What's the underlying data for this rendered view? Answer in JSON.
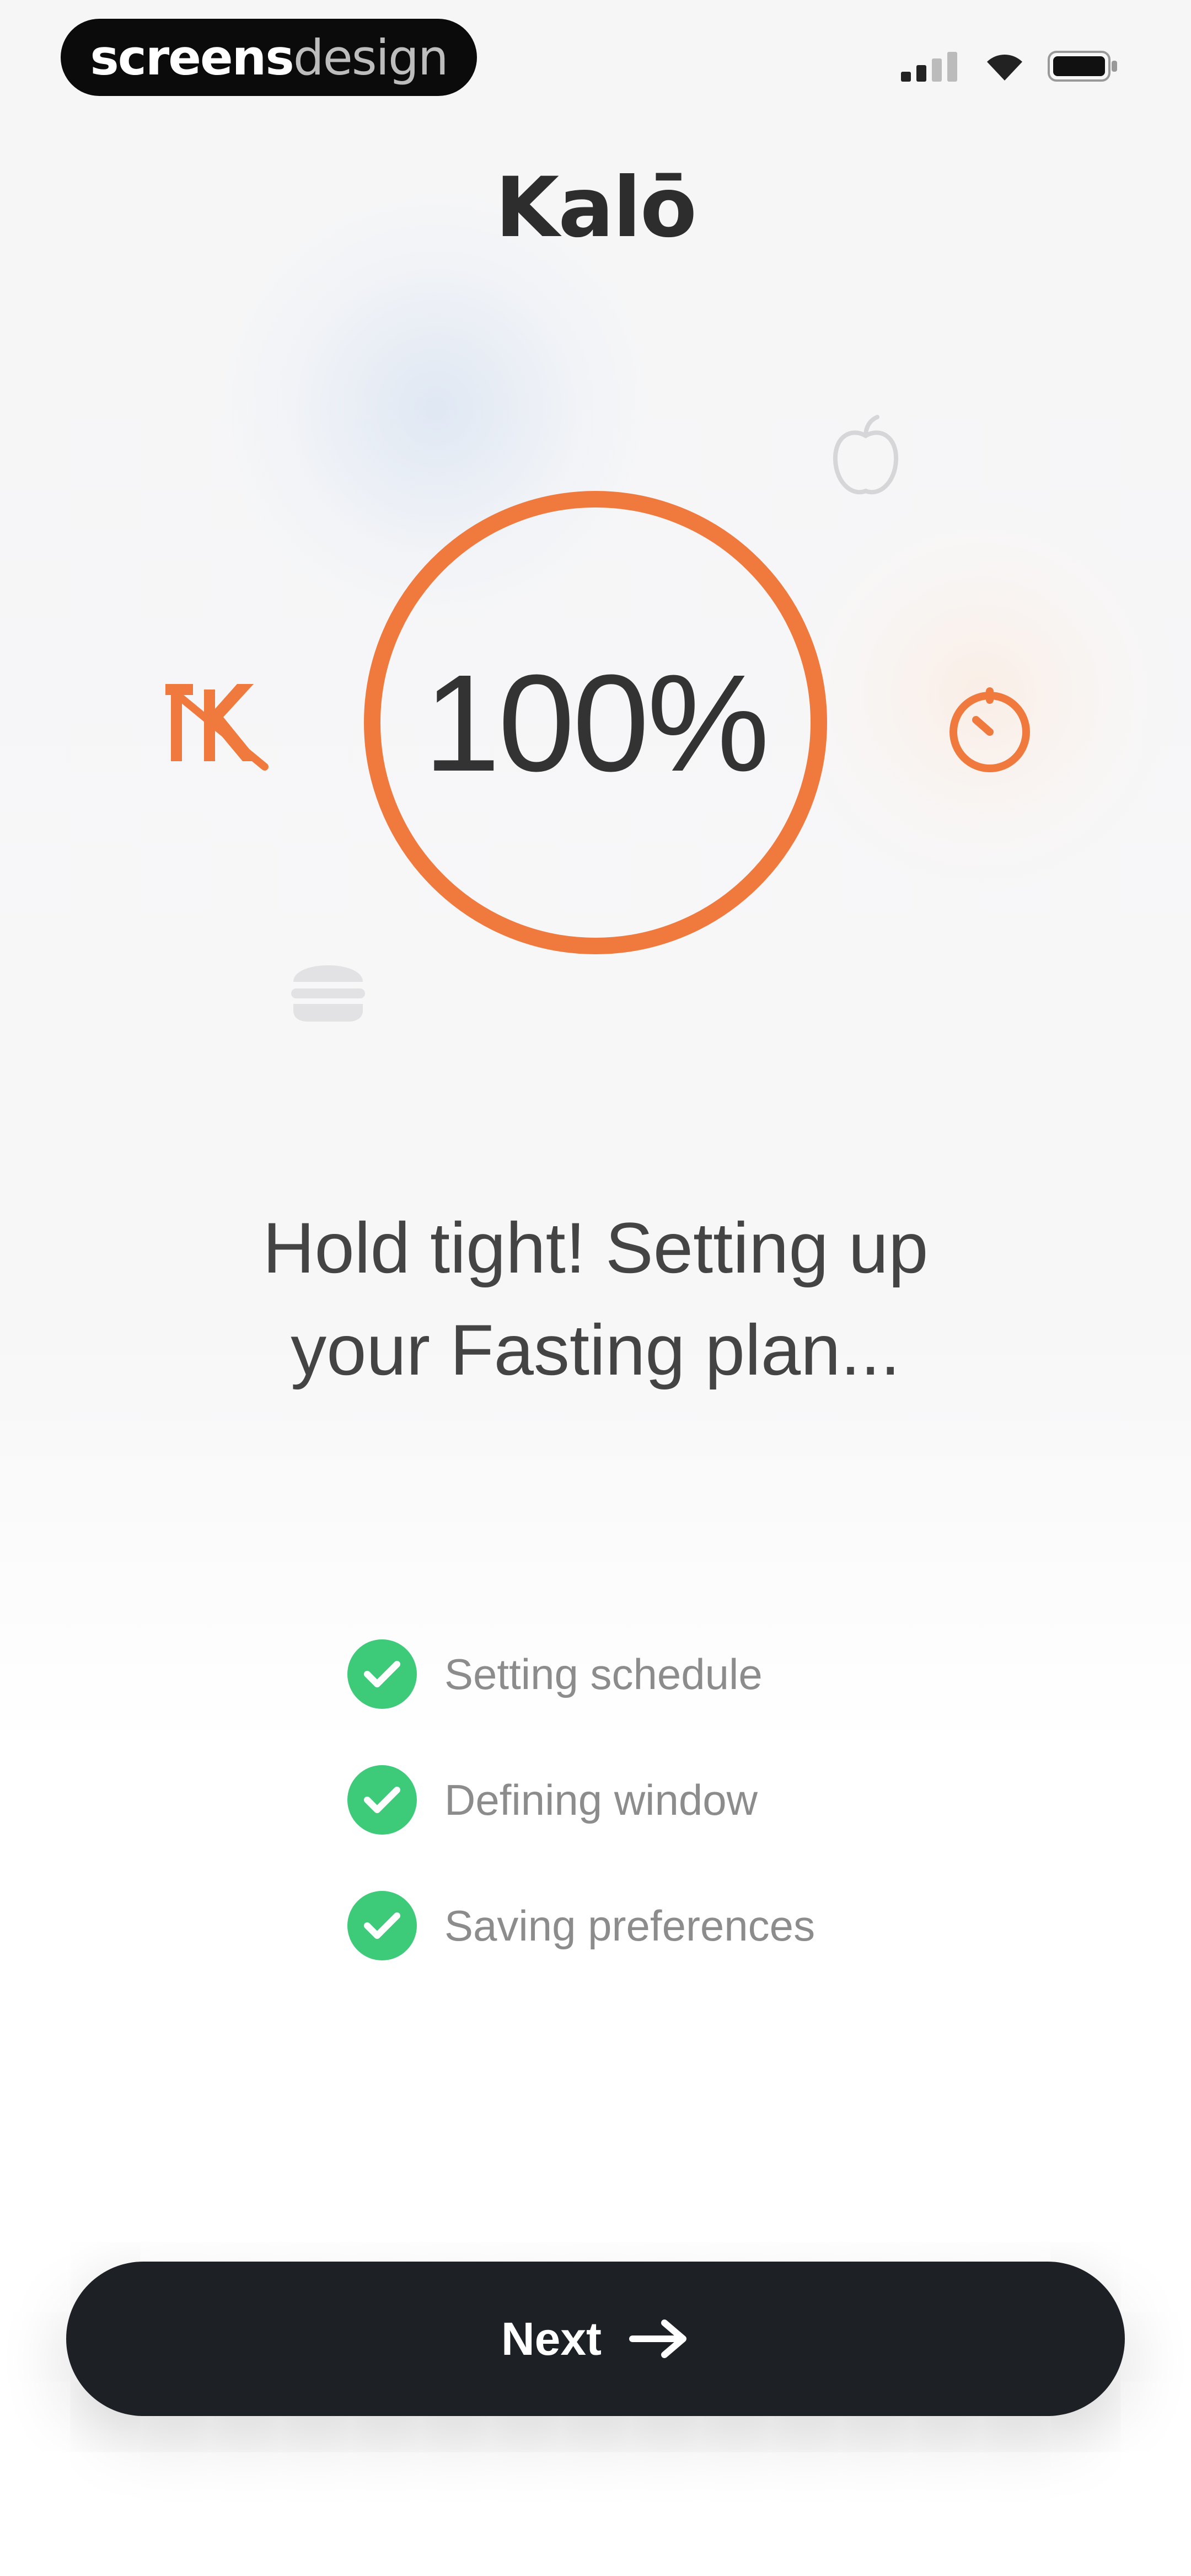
{
  "status_bar": {
    "brand_bold": "screens",
    "brand_light": "design",
    "icons": [
      "signal-icon",
      "wifi-icon",
      "battery-icon"
    ]
  },
  "header": {
    "app_title": "Kalō"
  },
  "progress": {
    "label": "100%",
    "value": 1.0
  },
  "headline": {
    "line1": "Hold tight! Setting up",
    "line2": "your Fasting plan..."
  },
  "checklist": [
    {
      "label": "Setting schedule",
      "done": true
    },
    {
      "label": "Defining window",
      "done": true
    },
    {
      "label": "Saving preferences",
      "done": true
    }
  ],
  "next_button": {
    "label": "Next",
    "icon": "arrow-right-icon"
  },
  "colors": {
    "accent": "#f07a3e",
    "success": "#3dcb79",
    "button": "#1d2125",
    "text": "#333333"
  },
  "decorative_icons": [
    "no-food-icon",
    "timer-icon",
    "apple-icon",
    "burger-icon"
  ]
}
